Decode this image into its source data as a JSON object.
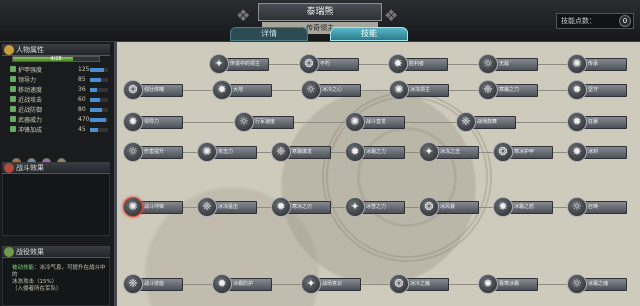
{
  "header": {
    "name": "泰瑞熊",
    "title": "传奇领主",
    "tabs": [
      {
        "label": "详情"
      },
      {
        "label": "技能"
      }
    ],
    "skill_points_label": "技能点数：",
    "skill_points_value": "0"
  },
  "left": {
    "section_attributes": "人物属性",
    "hp_text": "4/28",
    "hp_fraction": 0.7,
    "stats": [
      {
        "label": "护甲强度",
        "value": "125",
        "fill": 0.8
      },
      {
        "label": "领导力",
        "value": "85",
        "fill": 0.6
      },
      {
        "label": "移动速度",
        "value": "36",
        "fill": 0.4
      },
      {
        "label": "近战攻击",
        "value": "60",
        "fill": 0.55
      },
      {
        "label": "近战防御",
        "value": "80",
        "fill": 0.65
      },
      {
        "label": "武器威力",
        "value": "470",
        "fill": 0.9
      },
      {
        "label": "冲锋加成",
        "value": "45",
        "fill": 0.45
      }
    ],
    "section_effects": "战斗效果",
    "section_traits": "战役效果",
    "trait_desc_1": "被动技能：",
    "trait_desc_2": "冰冷气息，可提升在战斗中的",
    "trait_desc_3": "冰冻攻击（15%）",
    "trait_desc_4": "（入侵者所在军队）"
  },
  "colors": {
    "accent": "#58b8c8",
    "skill_plate": "#6b7076",
    "parchment": "#cfcbbc",
    "hp": "#8ecb55"
  },
  "skill_rows": [
    {
      "skills": [
        {
          "label": "传说中的领主"
        },
        {
          "label": "不朽"
        },
        {
          "label": "胜利者"
        },
        {
          "label": "无敌"
        },
        {
          "label": "传承"
        }
      ]
    },
    {
      "skills": [
        {
          "label": "强壮体魄"
        },
        {
          "label": "大地"
        },
        {
          "label": "冰冷之心"
        },
        {
          "label": "冰冻领主"
        },
        {
          "label": "寒霜之力"
        },
        {
          "label": "坚守"
        }
      ]
    },
    {
      "skills": [
        {
          "label": "领导力"
        },
        {
          "label": "行军速度"
        },
        {
          "label": "战斗直觉"
        },
        {
          "label": "战场鼓舞"
        },
        {
          "label": "狂暴"
        }
      ]
    },
    {
      "skills": [
        {
          "label": "伤害提升"
        },
        {
          "label": "攻击力"
        },
        {
          "label": "寒霜爆发"
        },
        {
          "label": "冰霜之力"
        },
        {
          "label": "冰冻之击"
        },
        {
          "label": "寒冰护甲"
        },
        {
          "label": "冰封"
        }
      ]
    },
    {
      "skills": [
        {
          "label": "战斗冲锋"
        },
        {
          "label": "冰冻猛击"
        },
        {
          "label": "寒冰之刃"
        },
        {
          "label": "冰雪之力"
        },
        {
          "label": "冰风暴"
        },
        {
          "label": "冰霜之怒"
        },
        {
          "label": "召唤"
        }
      ]
    },
    {
      "skills": [
        {
          "label": "战斗技能"
        },
        {
          "label": "冰霜防护"
        },
        {
          "label": "战场意识"
        },
        {
          "label": "冰冷之触"
        },
        {
          "label": "极寒冰霜"
        },
        {
          "label": "冰霜之魂"
        }
      ]
    }
  ]
}
